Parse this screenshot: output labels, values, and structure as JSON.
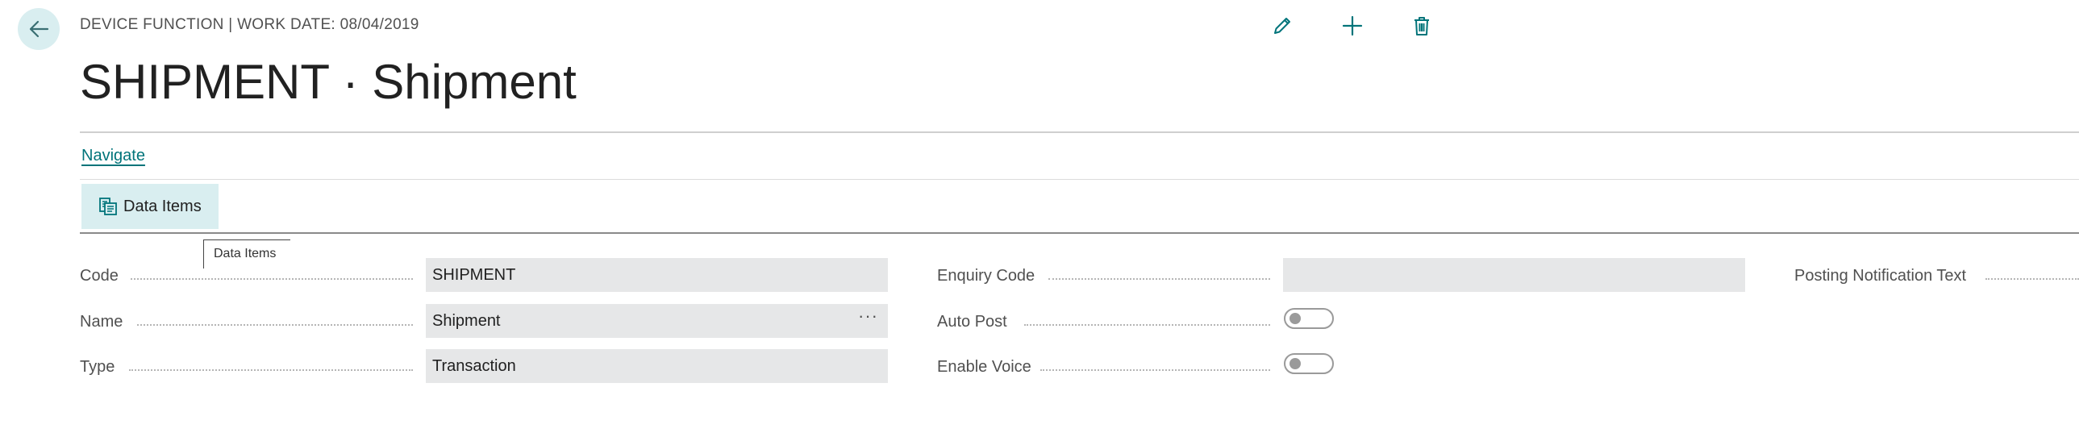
{
  "header": {
    "caption": "DEVICE FUNCTION | WORK DATE: 08/04/2019",
    "title": "SHIPMENT · Shipment"
  },
  "toolbar": {
    "back_icon": "arrow-left-icon",
    "edit_icon": "pencil-icon",
    "new_icon": "plus-icon",
    "delete_icon": "trash-icon"
  },
  "nav": {
    "navigate_label": "Navigate"
  },
  "actions": {
    "data_items_label": "Data Items",
    "data_items_icon": "data-items-icon"
  },
  "tooltip": {
    "text": "Data Items"
  },
  "fields": {
    "code": {
      "label": "Code",
      "value": "SHIPMENT"
    },
    "name": {
      "label": "Name",
      "value": "Shipment",
      "assist": "···"
    },
    "type": {
      "label": "Type",
      "value": "Transaction"
    },
    "enquiry_code": {
      "label": "Enquiry Code",
      "value": ""
    },
    "auto_post": {
      "label": "Auto Post",
      "on": false
    },
    "enable_voice": {
      "label": "Enable Voice",
      "on": false
    },
    "posting_notification_text": {
      "label": "Posting Notification Text"
    }
  },
  "colors": {
    "accent": "#00747a",
    "accent_light": "#d9eef0",
    "field_bg": "#e6e7e8"
  }
}
